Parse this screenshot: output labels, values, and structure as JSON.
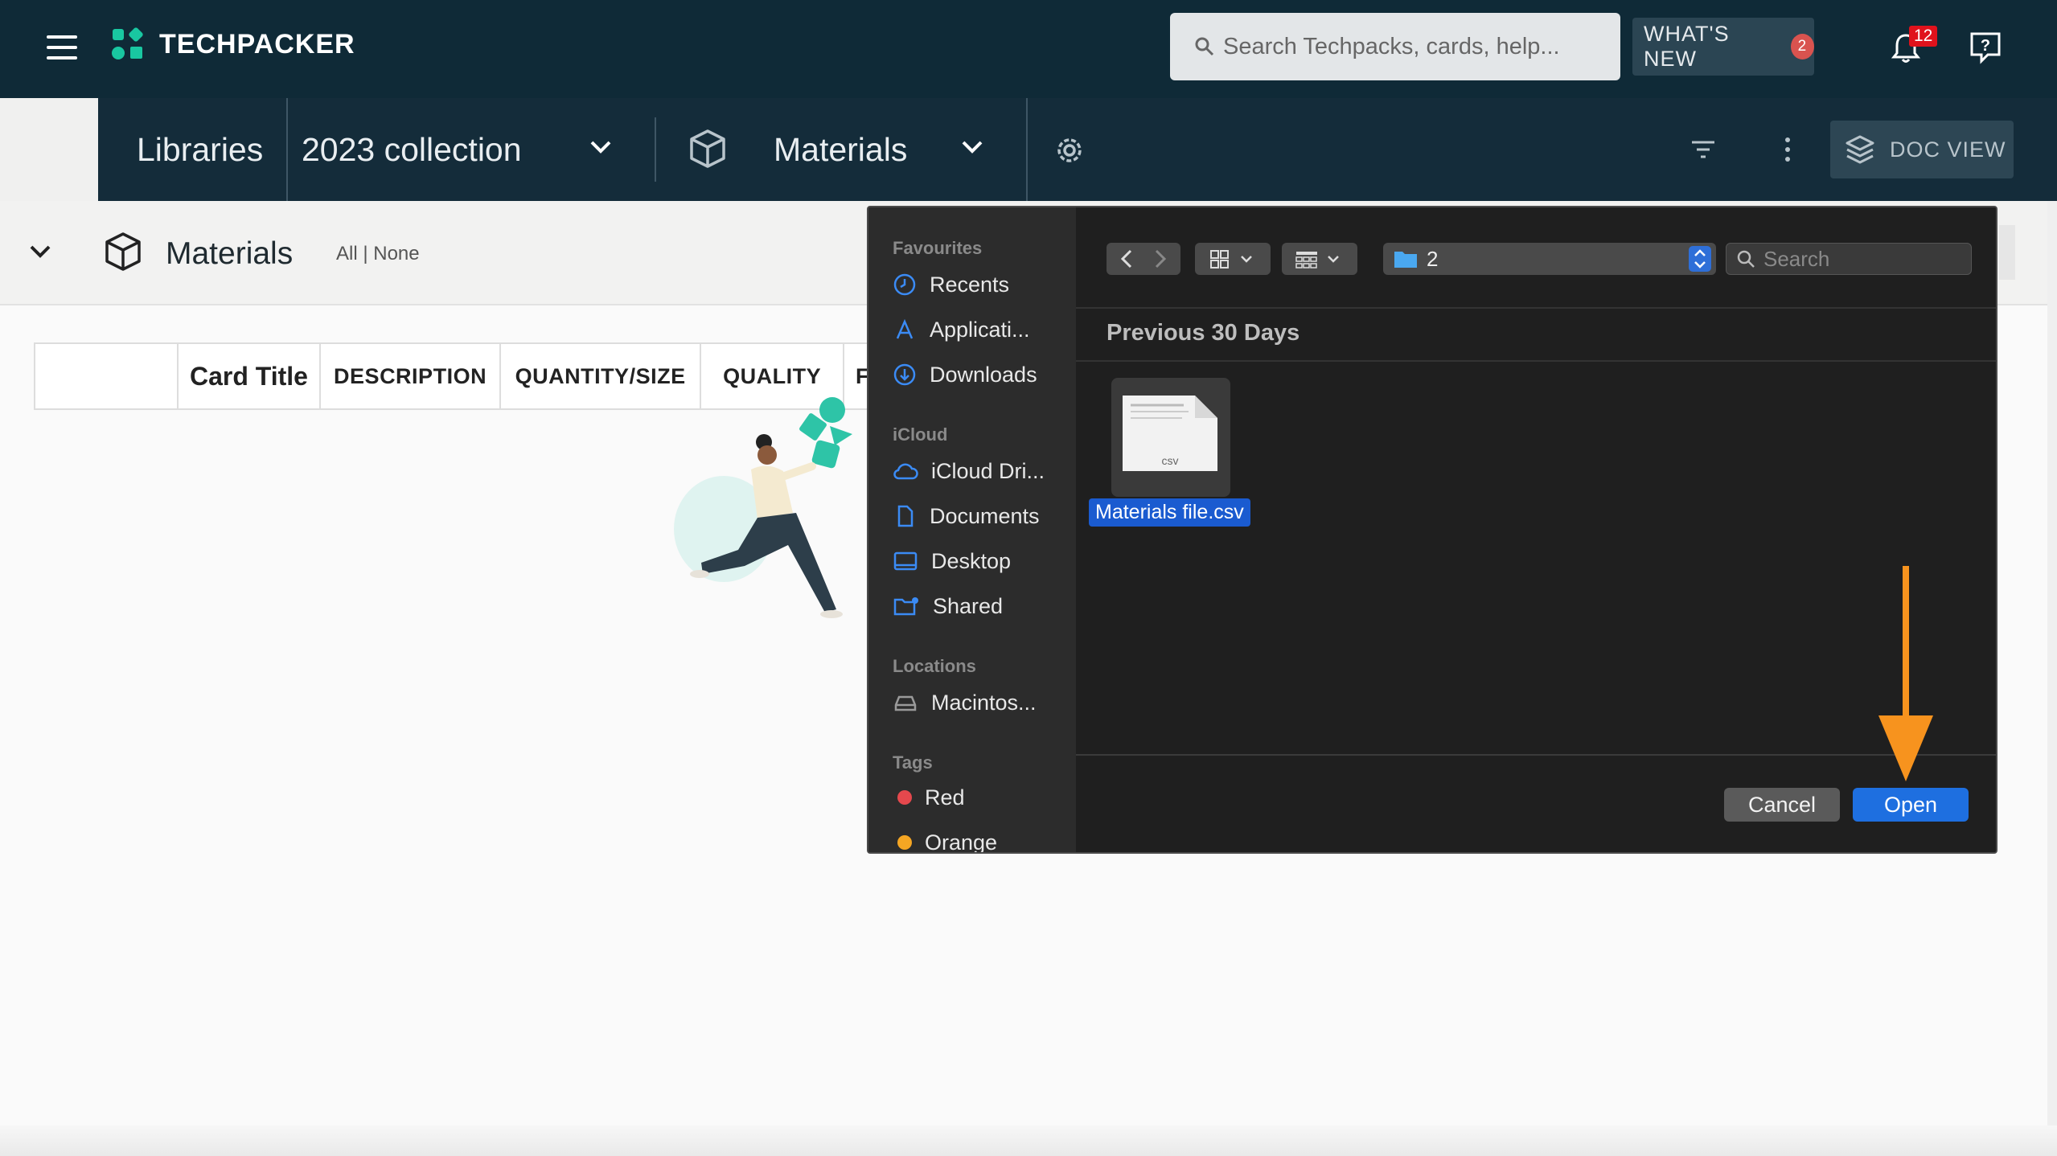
{
  "app": {
    "brand": "TECHPACKER",
    "search_placeholder": "Search Techpacks, cards, help...",
    "whats_new_label": "WHAT'S NEW",
    "whats_new_count": "2",
    "notifications_count": "12"
  },
  "nav": {
    "libraries_label": "Libraries",
    "collection_label": "2023 collection",
    "section_label": "Materials",
    "doc_view_label": "DOC VIEW"
  },
  "subheader": {
    "title": "Materials",
    "select_all": "All",
    "separator": "|",
    "select_none": "None"
  },
  "table": {
    "columns": [
      "",
      "Card Title",
      "DESCRIPTION",
      "QUANTITY/SIZE",
      "QUALITY",
      "F"
    ]
  },
  "file_dialog": {
    "sidebar": {
      "favourites_heading": "Favourites",
      "favourites": [
        "Recents",
        "Applicati...",
        "Downloads"
      ],
      "icloud_heading": "iCloud",
      "icloud": [
        "iCloud Dri...",
        "Documents",
        "Desktop",
        "Shared"
      ],
      "locations_heading": "Locations",
      "locations": [
        "Macintos..."
      ],
      "tags_heading": "Tags",
      "tags": [
        {
          "label": "Red",
          "color": "#e5484d"
        },
        {
          "label": "Orange",
          "color": "#f5a623"
        }
      ]
    },
    "current_folder": "2",
    "search_placeholder": "Search",
    "group_title": "Previous 30 Days",
    "file": {
      "name": "Materials file.csv",
      "ext_label": "csv"
    },
    "cancel_label": "Cancel",
    "open_label": "Open"
  },
  "colors": {
    "topbar": "#0f2a37",
    "brand_accent": "#19c7a1",
    "primary_blue": "#1e6fe0",
    "annotation_arrow": "#f7931e"
  }
}
